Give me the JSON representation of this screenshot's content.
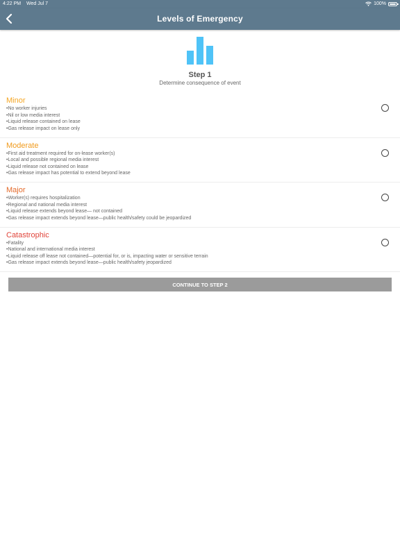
{
  "status_bar": {
    "time": "4:22 PM",
    "date": "Wed Jul 7",
    "battery": "100%"
  },
  "nav": {
    "title": "Levels of Emergency",
    "back_icon": "chevron-left-icon"
  },
  "hero": {
    "icon": "bar-chart-icon",
    "icon_color": "#4fc3f7",
    "bar_levels": [
      0.5,
      1.0,
      0.68
    ],
    "step_title": "Step 1",
    "step_subtitle": "Determine consequence of event"
  },
  "levels": [
    {
      "title": "Minor",
      "color": "#f5a623",
      "lines": [
        "•No worker injuries",
        "•Nil or low media interest",
        "•Liquid release contained on lease",
        "•Gas release impact on lease only"
      ]
    },
    {
      "title": "Moderate",
      "color": "#f09a1c",
      "lines": [
        "•First aid treatment required for on-lease worker(s)",
        "•Local and possible regional media interest",
        "•Liquid release not contained on lease",
        "•Gas release impact has potential to extend beyond lease"
      ]
    },
    {
      "title": "Major",
      "color": "#e46a2a",
      "lines": [
        "•Worker(s) requires hospitalization",
        "•Regional and national media interest",
        "•Liquid release extends beyond lease— not contained",
        "•Gas release impact extends beyond lease—public health/safety could be jeopardized"
      ]
    },
    {
      "title": "Catastrophic",
      "color": "#e0443a",
      "lines": [
        "•Fatality",
        "•National and international media interest",
        "•Liquid release off lease not contained—potential for, or is, impacting water or sensitive terrain",
        "•Gas release impact extends beyond lease—public health/safety jeopardized"
      ]
    }
  ],
  "continue_button": {
    "label": "CONTINUE TO STEP 2"
  }
}
